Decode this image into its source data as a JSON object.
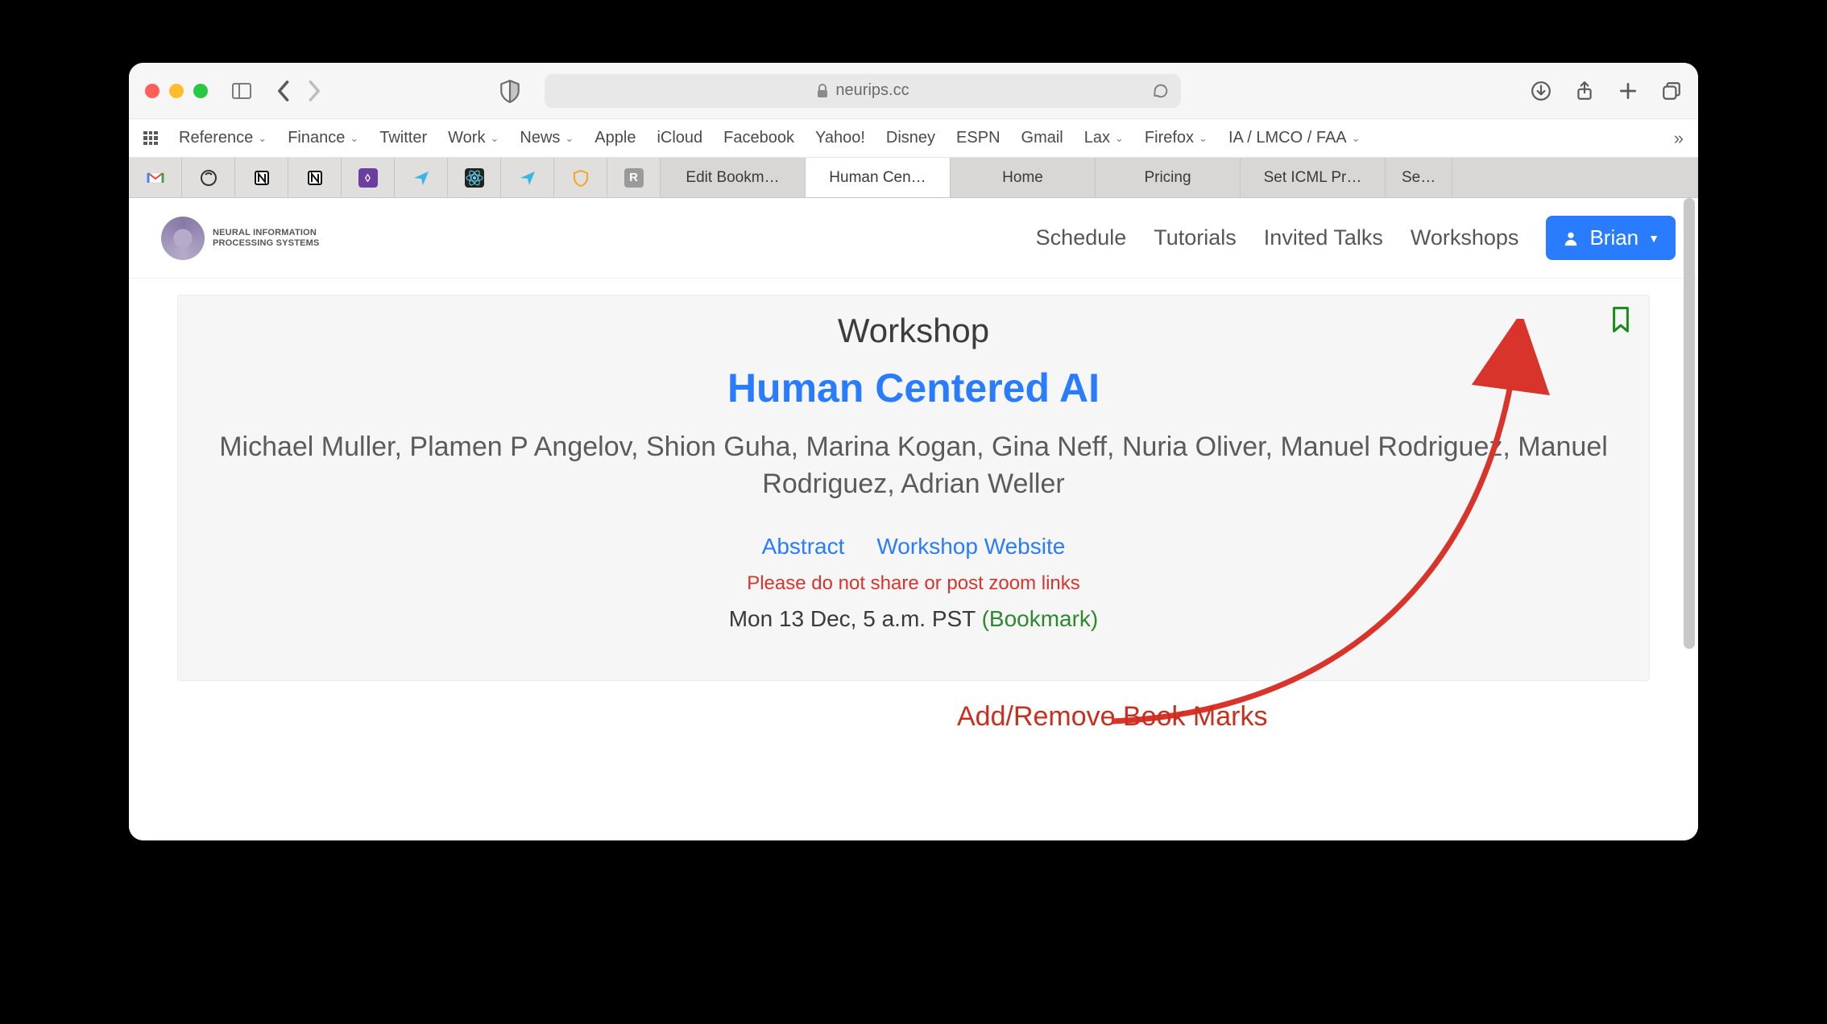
{
  "browser": {
    "url_host": "neurips.cc",
    "favorites": [
      {
        "label": "Reference",
        "dropdown": true
      },
      {
        "label": "Finance",
        "dropdown": true
      },
      {
        "label": "Twitter",
        "dropdown": false
      },
      {
        "label": "Work",
        "dropdown": true
      },
      {
        "label": "News",
        "dropdown": true
      },
      {
        "label": "Apple",
        "dropdown": false
      },
      {
        "label": "iCloud",
        "dropdown": false
      },
      {
        "label": "Facebook",
        "dropdown": false
      },
      {
        "label": "Yahoo!",
        "dropdown": false
      },
      {
        "label": "Disney",
        "dropdown": false
      },
      {
        "label": "ESPN",
        "dropdown": false
      },
      {
        "label": "Gmail",
        "dropdown": false
      },
      {
        "label": "Lax",
        "dropdown": true
      },
      {
        "label": "Firefox",
        "dropdown": true
      },
      {
        "label": "IA / LMCO / FAA",
        "dropdown": true
      }
    ],
    "tabs": [
      {
        "label": "Edit Bookm…",
        "active": false
      },
      {
        "label": "Human Cen…",
        "active": true
      },
      {
        "label": "Home",
        "active": false
      },
      {
        "label": "Pricing",
        "active": false
      },
      {
        "label": "Set ICML Pr…",
        "active": false
      },
      {
        "label": "Se…",
        "active": false
      }
    ]
  },
  "site": {
    "logo_text": "NEURAL INFORMATION\nPROCESSING SYSTEMS",
    "nav": [
      "Schedule",
      "Tutorials",
      "Invited Talks",
      "Workshops"
    ],
    "user": "Brian"
  },
  "event": {
    "kind": "Workshop",
    "title": "Human Centered AI",
    "authors": "Michael Muller, Plamen P Angelov, Shion Guha, Marina Kogan, Gina Neff, Nuria Oliver, Manuel Rodriguez, Manuel Rodriguez, Adrian Weller",
    "links": {
      "abstract": "Abstract",
      "website": "Workshop Website"
    },
    "warning": "Please do not share or post zoom links",
    "datetime": "Mon 13 Dec, 5 a.m. PST",
    "bookmark_label": "(Bookmark)"
  },
  "annotation": "Add/Remove Book Marks"
}
